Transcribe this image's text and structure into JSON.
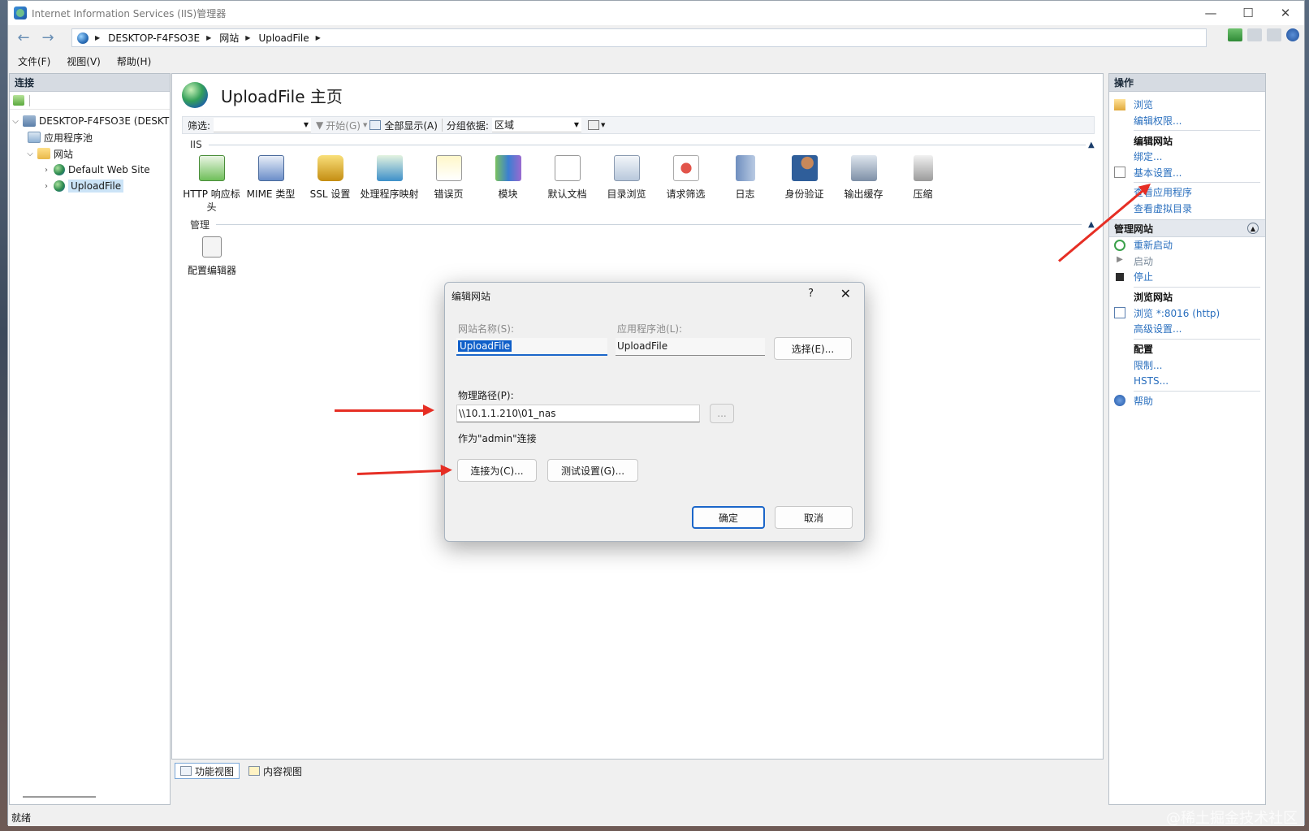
{
  "window": {
    "title": "Internet Information Services (IIS)管理器",
    "minimize": "—",
    "maximize": "☐",
    "close": "✕"
  },
  "address": {
    "crumbs": [
      "DESKTOP-F4FSO3E",
      "网站",
      "UploadFile"
    ]
  },
  "menu": {
    "file": "文件(F)",
    "view": "视图(V)",
    "help": "帮助(H)"
  },
  "connections": {
    "header": "连接",
    "tree": [
      {
        "label": "DESKTOP-F4FSO3E (DESKT"
      },
      {
        "label": "应用程序池"
      },
      {
        "label": "网站"
      },
      {
        "label": "Default Web Site"
      },
      {
        "label": "UploadFile"
      }
    ]
  },
  "center": {
    "title": "UploadFile 主页",
    "filter_label": "筛选:",
    "start_label": "开始(G)",
    "show_all_label": "全部显示(A)",
    "group_by_label": "分组依据:",
    "group_by_value": "区域",
    "section_iis": "IIS",
    "section_manage": "管理",
    "features_iis": [
      "HTTP 响应标头",
      "MIME 类型",
      "SSL 设置",
      "处理程序映射",
      "错误页",
      "模块",
      "默认文档",
      "目录浏览",
      "请求筛选",
      "日志",
      "身份验证",
      "输出缓存",
      "压缩"
    ],
    "features_manage": [
      "配置编辑器"
    ],
    "tab_features": "功能视图",
    "tab_content": "内容视图"
  },
  "actions": {
    "header": "操作",
    "browse": "浏览",
    "edit_perms": "编辑权限...",
    "edit_site_head": "编辑网站",
    "bindings": "绑定...",
    "basic_settings": "基本设置...",
    "view_apps": "查看应用程序",
    "view_vdirs": "查看虚拟目录",
    "manage_head": "管理网站",
    "restart": "重新启动",
    "start": "启动",
    "stop": "停止",
    "browse_head": "浏览网站",
    "browse_link": "浏览 *:8016 (http)",
    "advanced": "高级设置...",
    "config_head": "配置",
    "limits": "限制...",
    "hsts": "HSTS...",
    "help": "帮助"
  },
  "dialog": {
    "title": "编辑网站",
    "help": "?",
    "close": "✕",
    "site_name_label": "网站名称(S):",
    "site_name_value": "UploadFile",
    "app_pool_label": "应用程序池(L):",
    "app_pool_value": "UploadFile",
    "select_button": "选择(E)...",
    "physical_path_label": "物理路径(P):",
    "physical_path_value": "\\\\10.1.1.210\\01_nas",
    "browse_button": "...",
    "connect_as_text": "作为\"admin\"连接",
    "connect_as_button": "连接为(C)...",
    "test_settings_button": "测试设置(G)...",
    "ok_button": "确定",
    "cancel_button": "取消"
  },
  "status": {
    "text": "就绪"
  },
  "watermark": "@稀土掘金技术社区",
  "colors": {
    "link": "#2a6fbe",
    "arrow": "#e62e24",
    "selection": "#0f5fc9"
  }
}
